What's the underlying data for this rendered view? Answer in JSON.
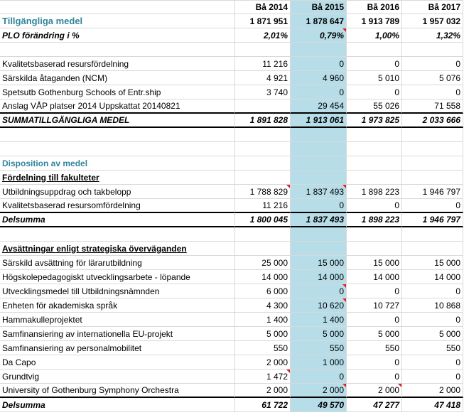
{
  "headers": [
    "",
    "Bå 2014",
    "Bå 2015",
    "Bå 2016",
    "Bå 2017"
  ],
  "rows": [
    {
      "id": "tillgangliga",
      "label": "Tillgängliga medel",
      "v": [
        "1 871 951",
        "1 878 647",
        "1 913 789",
        "1 957 032"
      ]
    },
    {
      "id": "plo",
      "label": "PLO förändring i %",
      "v": [
        "2,01%",
        "0,79%",
        "1,00%",
        "1,32%"
      ]
    },
    {
      "id": "blank1",
      "label": "",
      "v": [
        "",
        "",
        "",
        ""
      ]
    },
    {
      "id": "kval",
      "label": "Kvalitetsbaserad resursfördelning",
      "v": [
        "11 216",
        "0",
        "0",
        "0"
      ]
    },
    {
      "id": "sarskilda",
      "label": "Särskilda åtaganden (NCM)",
      "v": [
        "4 921",
        "4 960",
        "5 010",
        "5 076"
      ]
    },
    {
      "id": "spetsutb",
      "label": "Spetsutb Gothenburg Schools of Entr.ship",
      "v": [
        "3 740",
        "0",
        "0",
        "0"
      ]
    },
    {
      "id": "anslag",
      "label": "Anslag VÅP platser 2014 Uppskattat 20140821",
      "v": [
        "",
        "29 454",
        "55 026",
        "71 558"
      ]
    },
    {
      "id": "summa",
      "label": "SUMMATILLGÄNGLIGA MEDEL",
      "v": [
        "1 891 828",
        "1 913 061",
        "1 973 825",
        "2 033 666"
      ]
    },
    {
      "id": "blank2",
      "label": "",
      "v": [
        "",
        "",
        "",
        ""
      ]
    },
    {
      "id": "blank3",
      "label": "",
      "v": [
        "",
        "",
        "",
        ""
      ]
    },
    {
      "id": "disposition",
      "label": "Disposition av medel",
      "v": [
        "",
        "",
        "",
        ""
      ]
    },
    {
      "id": "fordelning",
      "label": "Fördelning till fakulteter",
      "v": [
        "",
        "",
        "",
        ""
      ]
    },
    {
      "id": "utbuppdrag",
      "label": "Utbildningsuppdrag och takbelopp",
      "v": [
        "1 788 829",
        "1 837 493",
        "1 898 223",
        "1 946 797"
      ]
    },
    {
      "id": "kvalomf",
      "label": "Kvalitetsbaserad resursomfördelning",
      "v": [
        "11 216",
        "0",
        "0",
        "0"
      ]
    },
    {
      "id": "delsumma1",
      "label": "Delsumma",
      "v": [
        "1 800 045",
        "1 837 493",
        "1 898 223",
        "1 946 797"
      ]
    },
    {
      "id": "blank4",
      "label": "",
      "v": [
        "",
        "",
        "",
        ""
      ]
    },
    {
      "id": "avsattningar",
      "label": "Avsättningar enligt strategiska överväganden",
      "v": [
        "",
        "",
        "",
        ""
      ]
    },
    {
      "id": "lararutb",
      "label": "Särskild avsättning för lärarutbildning",
      "v": [
        "25 000",
        "15 000",
        "15 000",
        "15 000"
      ]
    },
    {
      "id": "hogskoleped",
      "label": "Högskolepedagogiskt utvecklingsarbete - löpande",
      "v": [
        "14 000",
        "14 000",
        "14 000",
        "14 000"
      ]
    },
    {
      "id": "utvmedel",
      "label": "Utvecklingsmedel till Utbildningsnämnden",
      "v": [
        "6 000",
        "0",
        "0",
        "0"
      ]
    },
    {
      "id": "akadsprak",
      "label": "Enheten för akademiska språk",
      "v": [
        "4 300",
        "10 620",
        "10 727",
        "10 868"
      ]
    },
    {
      "id": "hammakulle",
      "label": "Hammakulleprojektet",
      "v": [
        "1 400",
        "1 400",
        "0",
        "0"
      ]
    },
    {
      "id": "samfineu",
      "label": "Samfinansiering av internationella EU-projekt",
      "v": [
        "5 000",
        "5 000",
        "5 000",
        "5 000"
      ]
    },
    {
      "id": "samfinpers",
      "label": "Samfinansiering av personalmobilitet",
      "v": [
        "550",
        "550",
        "550",
        "550"
      ]
    },
    {
      "id": "dacapo",
      "label": "Da Capo",
      "v": [
        "2 000",
        "1 000",
        "0",
        "0"
      ]
    },
    {
      "id": "grundtvig",
      "label": "Grundtvig",
      "v": [
        "1 472",
        "0",
        "0",
        "0"
      ]
    },
    {
      "id": "symphony",
      "label": "University of Gothenburg Symphony Orchestra",
      "v": [
        "2 000",
        "2 000",
        "2 000",
        "2 000"
      ]
    },
    {
      "id": "delsumma2",
      "label": "Delsumma",
      "v": [
        "61 722",
        "49 570",
        "47 277",
        "47 418"
      ]
    }
  ],
  "colors": {
    "highlight": "#b7dde8",
    "section_blue": "#31859c",
    "comment_marker": "#e02020"
  }
}
